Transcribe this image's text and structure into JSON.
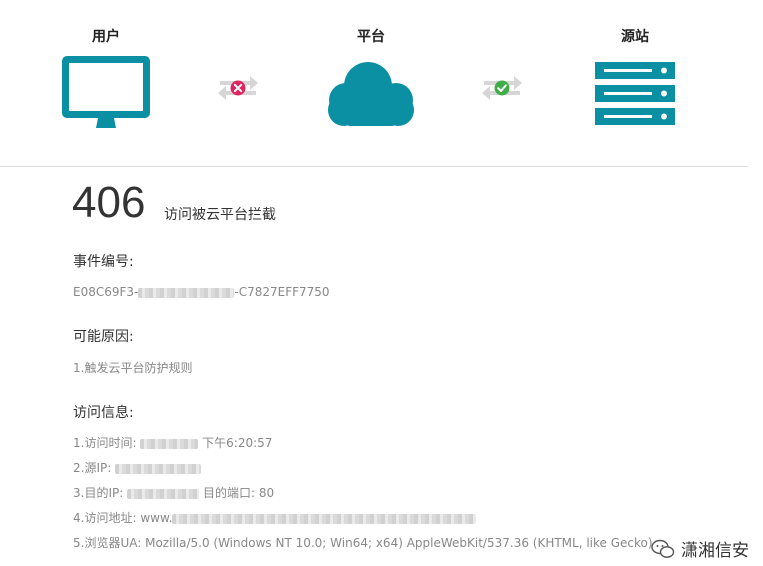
{
  "flow": {
    "user_label": "用户",
    "platform_label": "平台",
    "origin_label": "源站",
    "accent_color": "#0a8fa3",
    "blocked_color": "#e0245e",
    "ok_color": "#3fae49",
    "user_icon": "monitor-icon",
    "platform_icon": "cloud-icon",
    "origin_icon": "server-icon",
    "link1_status_icon": "blocked-x-icon",
    "link2_status_icon": "ok-check-icon"
  },
  "error": {
    "code": "406",
    "description": "访问被云平台拦截"
  },
  "event": {
    "title": "事件编号:",
    "id_prefix": "E08C69F3-",
    "id_suffix": "-C7827EFF7750"
  },
  "reason": {
    "title": "可能原因:",
    "item1": "1.触发云平台防护规则"
  },
  "access": {
    "title": "访问信息:",
    "time_label": "1.访问时间:",
    "time_value": "下午6:20:57",
    "src_ip_label": "2.源IP:",
    "dest_ip_label": "3.目的IP:",
    "dest_port_label": "目的端口:",
    "dest_port_value": "80",
    "url_label": "4.访问地址:",
    "url_prefix": "www.",
    "ua_label": "5.浏览器UA:",
    "ua_value": "Mozilla/5.0 (Windows NT 10.0; Win64; x64) AppleWebKit/537.36 (KHTML, like Gecko)"
  },
  "watermark": {
    "text": "潇湘信安",
    "icon": "wechat-icon"
  }
}
